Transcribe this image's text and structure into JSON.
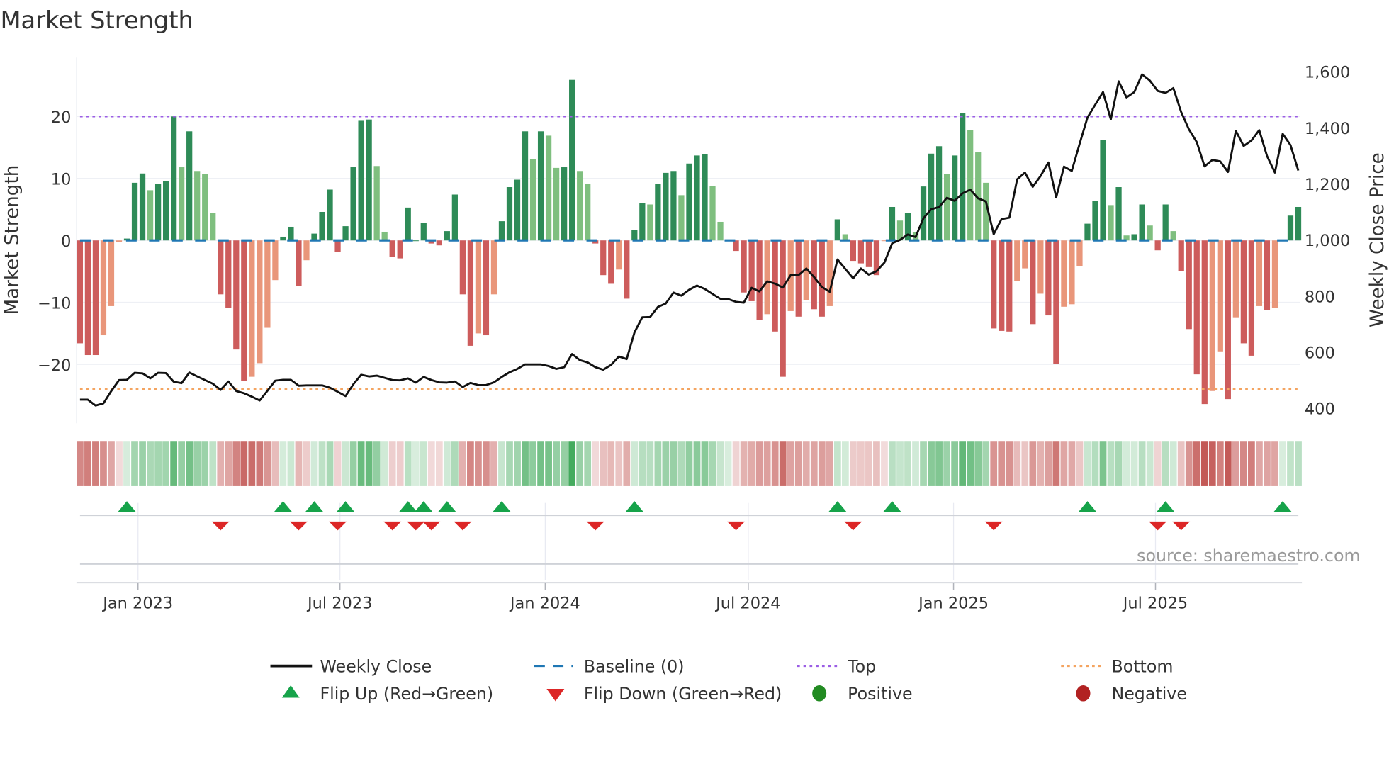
{
  "title": "Market Strength",
  "source": "source: sharemaestro.com",
  "legend": {
    "weekly_close": "Weekly Close",
    "baseline": "Baseline (0)",
    "top": "Top",
    "bottom": "Bottom",
    "flip_up": "Flip Up (Red→Green)",
    "flip_down": "Flip Down (Green→Red)",
    "positive": "Positive",
    "negative": "Negative"
  },
  "colors": {
    "green_strong": "#2e8b57",
    "green_weak": "#7fbf7f",
    "red_strong": "#cd5c5c",
    "red_weak": "#e9967a",
    "baseline": "#1f77b4",
    "top": "#9b5de5",
    "bottom": "#f4a460",
    "price": "#111111",
    "flip_up": "#16a34a",
    "flip_down": "#dc2626",
    "positive": "#228b22",
    "negative": "#b22222"
  },
  "chart_data": {
    "type": "bar",
    "title": "Market Strength",
    "x_start": "2022-11-10",
    "x_frequency": "weekly",
    "xticks": [
      {
        "label": "Jan 2023",
        "date": "2023-01-01"
      },
      {
        "label": "Jul 2023",
        "date": "2023-07-01"
      },
      {
        "label": "Jan 2024",
        "date": "2024-01-01"
      },
      {
        "label": "Jul 2024",
        "date": "2024-07-01"
      },
      {
        "label": "Jan 2025",
        "date": "2025-01-01"
      },
      {
        "label": "Jul 2025",
        "date": "2025-07-01"
      }
    ],
    "ylabel_left": "Market Strength",
    "ylim_left": [
      -29.5,
      29.5
    ],
    "yticks_left": [
      {
        "v": -20,
        "label": "−20"
      },
      {
        "v": -10,
        "label": "−10"
      },
      {
        "v": 0,
        "label": "0"
      },
      {
        "v": 10,
        "label": "10"
      },
      {
        "v": 20,
        "label": "20"
      }
    ],
    "ylabel_right": "Weekly Close Price",
    "ylim_right": [
      346,
      1650
    ],
    "yticks_right": [
      {
        "v": 400,
        "label": "400"
      },
      {
        "v": 600,
        "label": "600"
      },
      {
        "v": 800,
        "label": "800"
      },
      {
        "v": 1000,
        "label": "1,000"
      },
      {
        "v": 1200,
        "label": "1,200"
      },
      {
        "v": 1400,
        "label": "1,400"
      },
      {
        "v": 1600,
        "label": "1,600"
      }
    ],
    "top_level": 20,
    "bottom_level": -24,
    "baseline": 0,
    "grid": true,
    "legend_position": "bottom",
    "series": [
      {
        "name": "Market Strength",
        "values": [
          -16.6,
          -18.5,
          -18.5,
          -15.3,
          -10.6,
          -0.3,
          0.3,
          9.3,
          10.8,
          8.1,
          9.1,
          9.6,
          20,
          11.8,
          17.6,
          11.2,
          10.7,
          4.4,
          -8.7,
          -10.9,
          -17.6,
          -22.7,
          -22,
          -19.8,
          -14.1,
          -6.4,
          0.6,
          2.2,
          -7.4,
          -3.2,
          1.1,
          4.6,
          8.2,
          -1.9,
          2.3,
          11.8,
          19.3,
          19.5,
          12,
          1.4,
          -2.7,
          -2.9,
          5.3,
          0,
          2.8,
          -0.5,
          -0.8,
          1.5,
          7.4,
          -8.7,
          -17,
          -15,
          -15.3,
          -8.7,
          3.1,
          8.6,
          9.8,
          17.6,
          13.1,
          17.6,
          16.9,
          11.7,
          11.8,
          25.9,
          11.2,
          9.1,
          -0.5,
          -5.6,
          -7,
          -4.7,
          -9.4,
          1.7,
          6,
          5.8,
          9.1,
          10.9,
          11.2,
          7.3,
          12.4,
          13.7,
          13.9,
          8.8,
          3.0,
          0,
          -1.7,
          -8.4,
          -9.8,
          -12.8,
          -11.9,
          -14.7,
          -22,
          -11.4,
          -12.3,
          -9.6,
          -11.1,
          -12.3,
          -10.6,
          3.4,
          1,
          -3.3,
          -3.7,
          -4.3,
          -5.6,
          -0.1,
          5.4,
          3.2,
          4.4,
          1.3,
          8.7,
          14,
          15.2,
          10.7,
          13.7,
          20.6,
          17.8,
          14.2,
          9.3,
          -14.2,
          -14.6,
          -14.7,
          -6.5,
          -4.5,
          -13.5,
          -8.6,
          -12.1,
          -19.9,
          -10.7,
          -10.3,
          -4.1,
          2.7,
          6.4,
          16.2,
          5.7,
          8.6,
          0.8,
          1,
          5.8,
          2.4,
          -1.6,
          5.8,
          1.5,
          -4.9,
          -14.3,
          -21.6,
          -26.4,
          -24.3,
          -17.9,
          -25.6,
          -12.4,
          -16.6,
          -18.6,
          -10.6,
          -11.2,
          -10.9,
          0,
          4,
          5.4
        ]
      },
      {
        "name": "Weekly Close",
        "axis": "right",
        "values": [
          430,
          430,
          409,
          417,
          461,
          500,
          501,
          526,
          524,
          506,
          526,
          525,
          494,
          489,
          527,
          513,
          500,
          487,
          465,
          495,
          461,
          453,
          441,
          427,
          462,
          498,
          501,
          501,
          480,
          481,
          481,
          481,
          473,
          458,
          443,
          485,
          519,
          513,
          516,
          508,
          500,
          499,
          506,
          491,
          511,
          500,
          492,
          491,
          495,
          475,
          490,
          482,
          482,
          492,
          511,
          528,
          540,
          556,
          556,
          556,
          550,
          540,
          546,
          593,
          571,
          563,
          546,
          537,
          554,
          584,
          575,
          670,
          724,
          725,
          761,
          773,
          812,
          801,
          822,
          837,
          825,
          807,
          790,
          789,
          779,
          776,
          829,
          816,
          852,
          844,
          830,
          874,
          874,
          898,
          867,
          832,
          815,
          930,
          896,
          863,
          898,
          876,
          888,
          919,
          988,
          1000,
          1019,
          1010,
          1077,
          1109,
          1117,
          1150,
          1139,
          1166,
          1179,
          1148,
          1137,
          1020,
          1074,
          1079,
          1216,
          1240,
          1189,
          1228,
          1276,
          1151,
          1261,
          1246,
          1343,
          1436,
          1482,
          1527,
          1430,
          1565,
          1508,
          1527,
          1590,
          1568,
          1531,
          1524,
          1541,
          1456,
          1394,
          1348,
          1262,
          1285,
          1280,
          1242,
          1389,
          1335,
          1354,
          1391,
          1299,
          1240,
          1378,
          1338,
          1247
        ]
      }
    ],
    "flip_up_weeks": [
      6,
      26,
      30,
      34,
      42,
      44,
      47,
      54,
      71,
      97,
      104,
      129,
      139,
      154
    ],
    "flip_down_weeks": [
      18,
      28,
      33,
      40,
      43,
      45,
      49,
      66,
      84,
      99,
      117,
      138,
      141
    ]
  }
}
